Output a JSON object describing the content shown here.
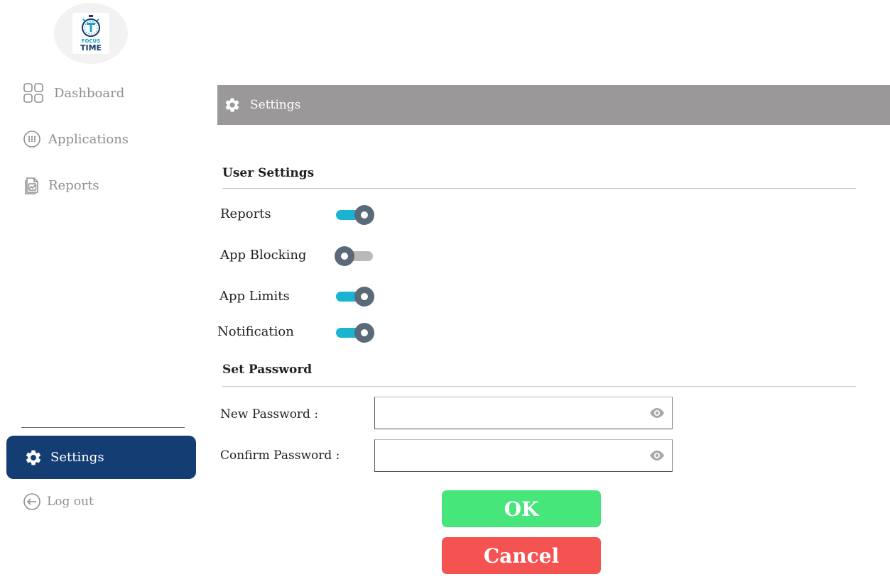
{
  "app": {
    "logo_text_top": "FOCUS",
    "logo_text_bottom": "TIME"
  },
  "sidebar": {
    "items": [
      {
        "label": "Dashboard",
        "icon": "grid-icon"
      },
      {
        "label": "Applications",
        "icon": "apps-dots-icon"
      },
      {
        "label": "Reports",
        "icon": "report-file-icon"
      }
    ],
    "active": {
      "label": "Settings",
      "icon": "gear-icon"
    },
    "logout": {
      "label": "Log out",
      "icon": "logout-icon"
    }
  },
  "header": {
    "title": "Settings",
    "icon": "gear-icon"
  },
  "user_settings": {
    "title": "User Settings",
    "toggles": [
      {
        "label": "Reports",
        "on": true
      },
      {
        "label": "App Blocking",
        "on": false
      },
      {
        "label": "App Limits",
        "on": true
      },
      {
        "label": "Notification",
        "on": true
      }
    ]
  },
  "password": {
    "title": "Set Password",
    "new_label": "New Password :",
    "new_value": "",
    "confirm_label": "Confirm Password :",
    "confirm_value": ""
  },
  "buttons": {
    "ok": "OK",
    "cancel": "Cancel"
  },
  "colors": {
    "sidebar_active": "#143d74",
    "header_bar": "#9a9898",
    "toggle_on": "#1ab4d0",
    "ok": "#46e67a",
    "cancel": "#f55252"
  }
}
